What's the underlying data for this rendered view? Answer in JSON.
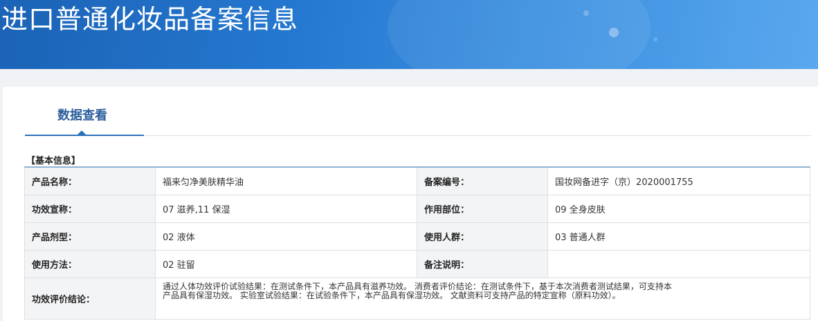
{
  "header": {
    "title": "进口普通化妆品备案信息"
  },
  "tabs": [
    {
      "label": "数据查看"
    }
  ],
  "section": {
    "title": "【基本信息】"
  },
  "info": {
    "product_name": {
      "label": "产品名称：",
      "value": "福来匀净美肤精华油"
    },
    "record_no": {
      "label": "备案编号：",
      "value": "国妆网备进字（京）2020001755"
    },
    "efficacy_claim": {
      "label": "功效宣称：",
      "value": "07 滋养,11 保湿"
    },
    "application_area": {
      "label": "作用部位：",
      "value": "09 全身皮肤"
    },
    "dosage_form": {
      "label": "产品剂型：",
      "value": "02 液体"
    },
    "target_group": {
      "label": "使用人群：",
      "value": "03 普通人群"
    },
    "usage_method": {
      "label": "使用方法：",
      "value": "02 驻留"
    },
    "remarks": {
      "label": "备注说明：",
      "value": ""
    },
    "efficacy_conclusion": {
      "label": "功效评价结论：",
      "value": "通过人体功效评价试验结果：在测试条件下，本产品具有滋养功效。 消费者评价结论：在测试条件下，基于本次消费者测试结果，可支持本产品具有保湿功效。 实验室试验结果：在试验条件下，本产品具有保湿功效。 文献资料可支持产品的特定宣称（原料功效）。"
    }
  }
}
